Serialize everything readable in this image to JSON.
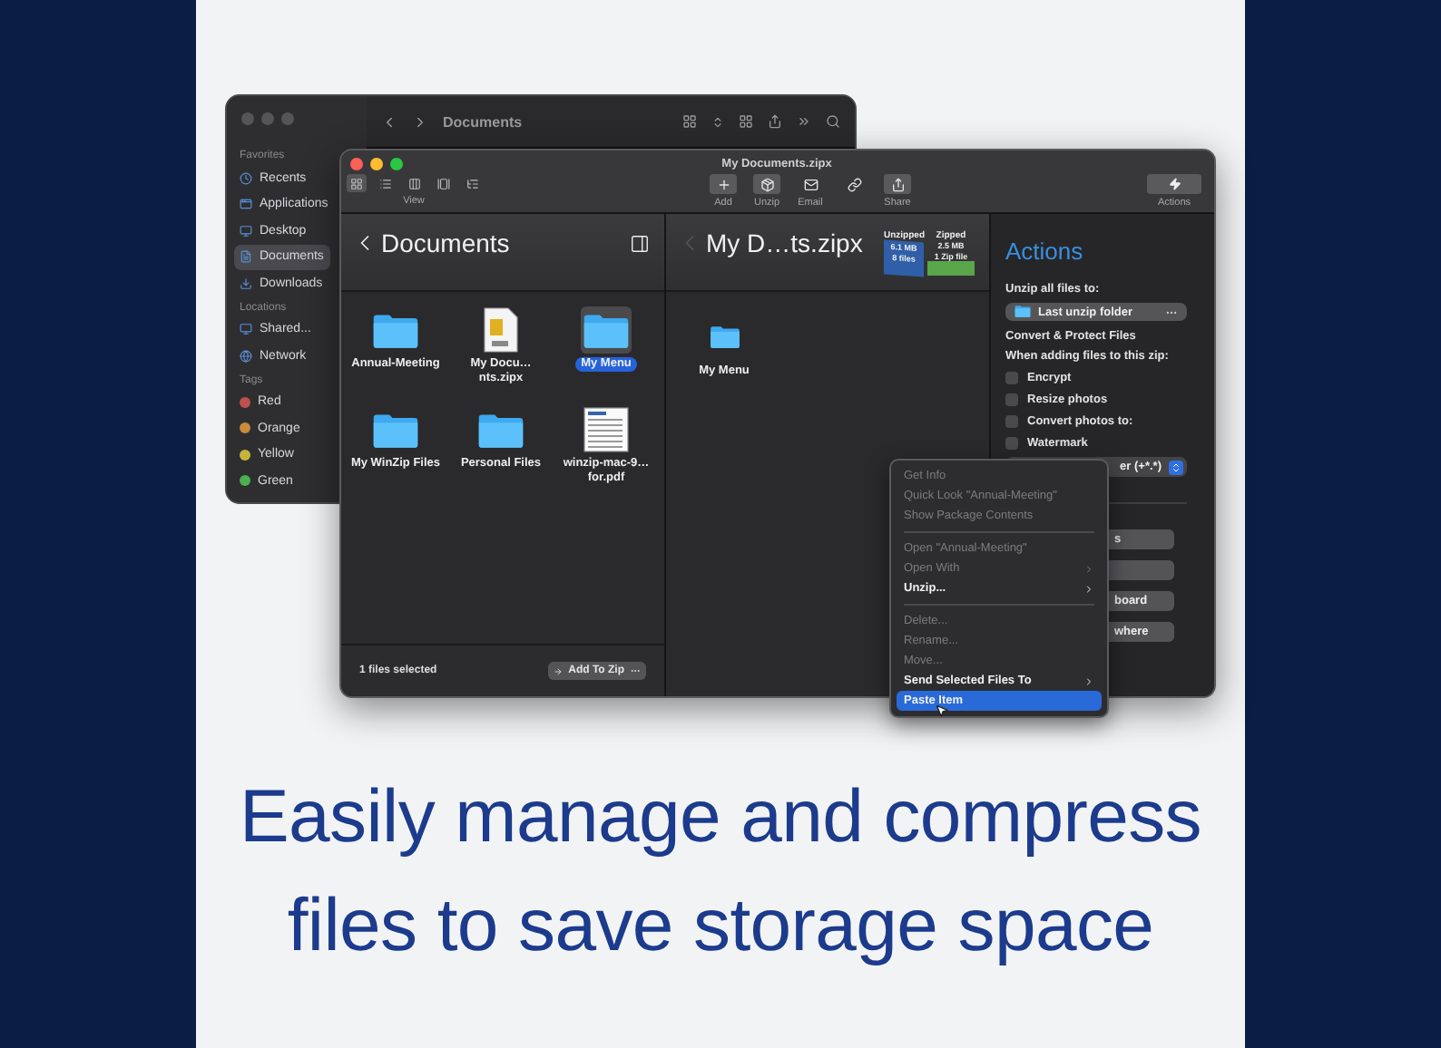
{
  "finder_window": {
    "title": "Documents",
    "sidebar": [
      {
        "heading": "Favorites",
        "kind": "places",
        "items": [
          {
            "label": "Recents",
            "selected": false
          },
          {
            "label": "Applications",
            "selected": false
          },
          {
            "label": "Desktop",
            "selected": false
          },
          {
            "label": "Documents",
            "selected": true
          },
          {
            "label": "Downloads",
            "selected": false
          }
        ]
      },
      {
        "heading": "Locations",
        "kind": "places",
        "items": [
          {
            "label": "Shared...",
            "selected": false
          },
          {
            "label": "Network",
            "selected": false
          }
        ]
      },
      {
        "heading": "Tags",
        "kind": "tags",
        "items": [
          {
            "label": "Red",
            "color": "#c0504d"
          },
          {
            "label": "Orange",
            "color": "#c98a3c"
          },
          {
            "label": "Yellow",
            "color": "#c8b43c"
          },
          {
            "label": "Green",
            "color": "#4caf50"
          }
        ]
      }
    ]
  },
  "winzip_window": {
    "title": "My Documents.zipx",
    "view_label": "View",
    "toolbar": [
      {
        "kind": "add",
        "label": "Add"
      },
      {
        "kind": "unzip",
        "label": "Unzip"
      },
      {
        "kind": "email",
        "label": "Email"
      },
      {
        "kind": "link"
      },
      {
        "kind": "share",
        "label": "Share"
      }
    ],
    "actions_button": {
      "label": "Actions"
    },
    "browser": {
      "title": "Documents",
      "files": [
        {
          "kind": "folder",
          "name": "Annual-Meeting",
          "selected": false
        },
        {
          "kind": "zip",
          "name": "My Docu…nts.zipx",
          "selected": false
        },
        {
          "kind": "folder",
          "name": "My Menu",
          "selected": true
        },
        {
          "kind": "folder",
          "name": "My WinZip Files",
          "selected": false
        },
        {
          "kind": "folder",
          "name": "Personal Files",
          "selected": false
        },
        {
          "kind": "pdf",
          "name": "winzip-mac-9…for.pdf",
          "selected": false
        }
      ],
      "status": "1 files selected",
      "add_button": "Add To Zip"
    },
    "zip_pane": {
      "title": "My D…ts.zipx",
      "unzipped": {
        "label": "Unzipped",
        "size": "6.1 MB",
        "count": "8 files"
      },
      "zipped": {
        "label": "Zipped",
        "size": "2.5 MB",
        "count": "1 Zip file"
      },
      "files": [
        {
          "kind": "folder",
          "name": "My Menu"
        }
      ]
    },
    "actions": {
      "title": "Actions",
      "unzip_label": "Unzip all files to:",
      "unzip_target": "Last unzip folder",
      "section": "Convert & Protect Files",
      "hint": "When adding files to this zip:",
      "options": [
        {
          "label": "Encrypt",
          "checked": false
        },
        {
          "label": "Resize photos",
          "checked": false
        },
        {
          "label": "Convert photos to:",
          "checked": false
        },
        {
          "label": "Watermark",
          "checked": false
        }
      ],
      "format": "er (+*.*)",
      "buttons": [
        {
          "kind": "button",
          "label": "s"
        },
        {
          "kind": "button"
        },
        {
          "kind": "button",
          "label": "board"
        },
        {
          "kind": "button",
          "label": "where"
        }
      ]
    }
  },
  "context_menu": [
    {
      "kind": "item",
      "label": "Get Info",
      "disabled": true,
      "submenu": false,
      "selected": false
    },
    {
      "kind": "item",
      "label": "Quick Look \"Annual-Meeting\"",
      "disabled": true,
      "submenu": false,
      "selected": false
    },
    {
      "kind": "item",
      "label": "Show Package Contents",
      "disabled": true,
      "submenu": false,
      "selected": false
    },
    {
      "kind": "separator"
    },
    {
      "kind": "item",
      "label": "Open \"Annual-Meeting\"",
      "disabled": true,
      "submenu": false,
      "selected": false
    },
    {
      "kind": "item",
      "label": "Open With",
      "disabled": true,
      "submenu": true,
      "selected": false
    },
    {
      "kind": "item",
      "label": "Unzip...",
      "disabled": false,
      "submenu": true,
      "selected": false
    },
    {
      "kind": "separator"
    },
    {
      "kind": "item",
      "label": "Delete...",
      "disabled": true,
      "submenu": false,
      "selected": false
    },
    {
      "kind": "item",
      "label": "Rename...",
      "disabled": true,
      "submenu": false,
      "selected": false
    },
    {
      "kind": "item",
      "label": "Move...",
      "disabled": true,
      "submenu": false,
      "selected": false
    },
    {
      "kind": "item",
      "label": "Send Selected Files To",
      "disabled": false,
      "submenu": true,
      "selected": false
    },
    {
      "kind": "item",
      "label": "Paste Item",
      "disabled": false,
      "submenu": false,
      "selected": true
    }
  ],
  "headline": "Easily manage and compress files to save storage space"
}
